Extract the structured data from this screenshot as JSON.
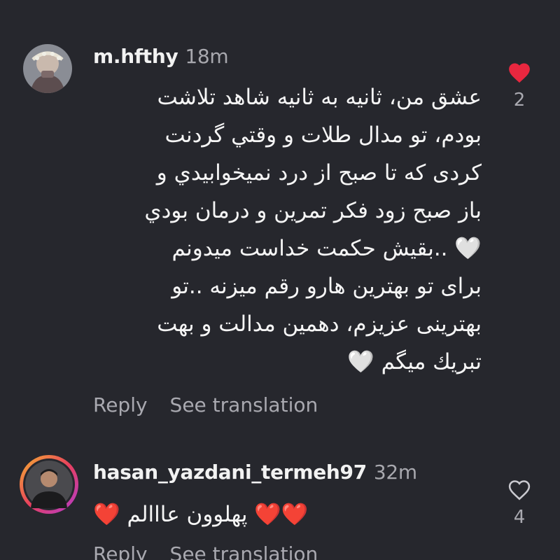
{
  "comments": [
    {
      "username": "m.hfthy",
      "time": "18m",
      "lines": [
        "عشق من، ثانیه به ثانیه شاهد تلاشت",
        "بودم، تو مدال طلات و وقتي گردنت",
        "کردی که تا صبح از درد نمیخوابیدي و",
        "باز صبح زود فکر تمرین و درمان بودي",
        "🤍 ..بقیش حکمت خداست میدونم",
        "برای تو بهترین هارو رقم میزنه ..تو",
        "بهترینی عزیزم، دهمین مدالت و بهت",
        "تبریك میگم 🤍"
      ],
      "reply_label": "Reply",
      "translate_label": "See translation",
      "like_icon": "heart-filled-icon",
      "like_count": "2",
      "like_color": "#e8273f"
    },
    {
      "username": "hasan_yazdani_termeh97",
      "time": "32m",
      "text": "❤️❤️ پهلوون عااالم ❤️",
      "reply_label": "Reply",
      "translate_label": "See translation",
      "like_icon": "heart-outline-icon",
      "like_count": "4"
    }
  ]
}
